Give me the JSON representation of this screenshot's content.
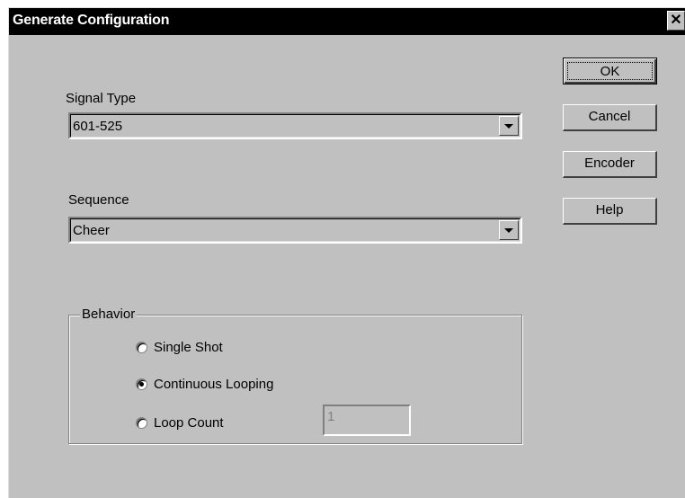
{
  "dialog": {
    "title": "Generate Configuration",
    "close_glyph": "✕"
  },
  "signal_type": {
    "label": "Signal Type",
    "value": "601-525"
  },
  "sequence": {
    "label": "Sequence",
    "value": "Cheer"
  },
  "buttons": {
    "ok": "OK",
    "cancel": "Cancel",
    "encoder": "Encoder",
    "help": "Help"
  },
  "behavior": {
    "legend": "Behavior",
    "options": [
      {
        "label": "Single Shot",
        "checked": false
      },
      {
        "label": "Continuous Looping",
        "checked": true
      },
      {
        "label": "Loop Count",
        "checked": false
      }
    ],
    "loop_count_value": "1"
  },
  "colors": {
    "dialog_face": "#c0c0c0",
    "titlebar": "#000000"
  },
  "icons": [
    "close-icon",
    "dropdown-arrow-icon",
    "radio-button"
  ]
}
